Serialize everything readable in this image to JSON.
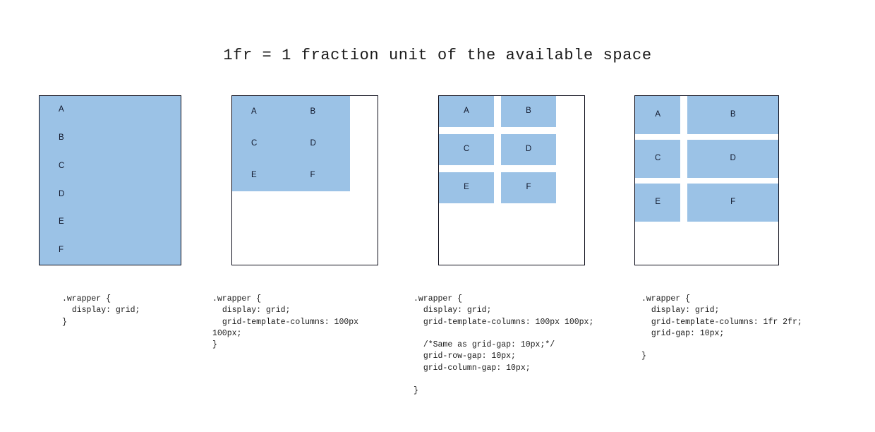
{
  "title": "1fr = 1 fraction unit of the available space",
  "colors": {
    "cell_fill": "#9bc2e6",
    "frame_border": "#0d0d1a",
    "text": "#10172b",
    "code_text": "#1a1a1a",
    "page_background": "#ffffff"
  },
  "panels": [
    {
      "id": "panel-display-grid",
      "items": [
        "A",
        "B",
        "C",
        "D",
        "E",
        "F"
      ],
      "code": ".wrapper {\n  display: grid;\n}"
    },
    {
      "id": "panel-fixed-columns",
      "items": [
        "A",
        "B",
        "C",
        "D",
        "E",
        "F"
      ],
      "code": ".wrapper {\n  display: grid;\n  grid-template-columns: 100px 100px;\n}"
    },
    {
      "id": "panel-row-column-gap",
      "items": [
        "A",
        "B",
        "C",
        "D",
        "E",
        "F"
      ],
      "code": ".wrapper {\n  display: grid;\n  grid-template-columns: 100px 100px;\n\n  /*Same as grid-gap: 10px;*/\n  grid-row-gap: 10px;\n  grid-column-gap: 10px;\n\n}"
    },
    {
      "id": "panel-fr-units",
      "items": [
        "A",
        "B",
        "C",
        "D",
        "E",
        "F"
      ],
      "code": ".wrapper {\n  display: grid;\n  grid-template-columns: 1fr 2fr;\n  grid-gap: 10px;\n\n}"
    }
  ]
}
